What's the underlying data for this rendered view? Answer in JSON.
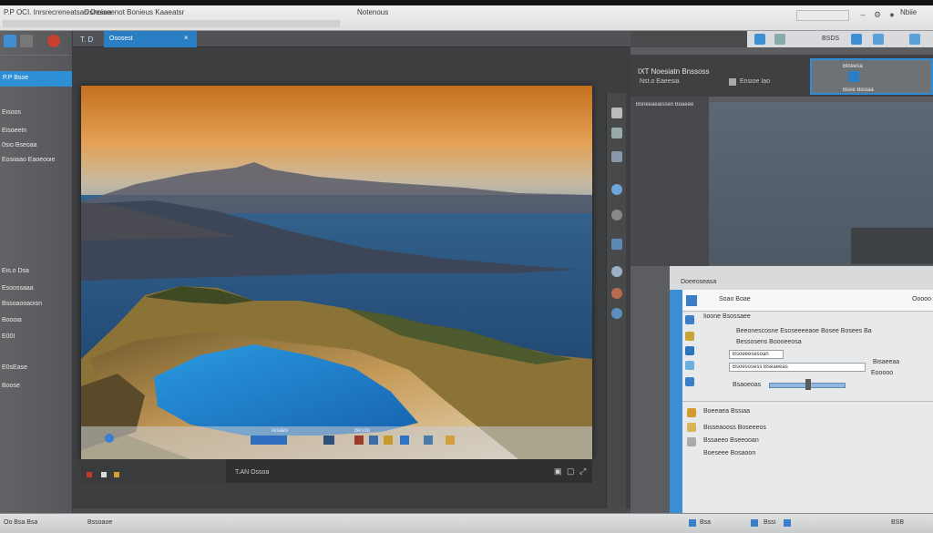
{
  "titlebar": {
    "left_text": "P.P OCI. Inrsrecreneatsan Oesea",
    "mid_text": "Osnoiseenot Bonieus Kaaeatsr",
    "center_text": "Notenous",
    "right_text": "Nbiie"
  },
  "doc_tabs": {
    "label1": "T. D",
    "label2": "Ososest"
  },
  "sidebar": {
    "active_item": "P.P   Bsoe",
    "items": [
      "Eisoos",
      "Eisoeetn",
      "0sio Bseoaa",
      "Eosiiaao Eaoeooie",
      "Eis.o Dsa",
      "Esoossaaa",
      "Bssoaooaoisn",
      "Boooia",
      "E00I",
      "E0sEase",
      "Boose"
    ]
  },
  "rightpanel": {
    "top_label": "BSDS",
    "header_title": "IXT Noesiatn Bnssoss",
    "header_sub1": "Nst.o Eaeesia",
    "header_sub2": "Ensioe Iao",
    "thumb_label1": "Bloeesa",
    "thumb_label2": "Bsoe Bisoaa",
    "mid_label": "Bsneeaeaissen Boaeee",
    "lower_title": "Doeeoseasa",
    "inner_label": "Soao Boae",
    "inner_right": "Ooooo",
    "rows": [
      "Iioone Bsossaee",
      "Beeonescosne Esoseeeeaoe Bosee Bosees Ba",
      "Bessosens Boooeeosa",
      "Bsoeeesesoan",
      "Bsoesosess Bseaeeas",
      "Bsaoeoas",
      "Boeeaea Bssiaa",
      "Bisseaooss Boseeeos",
      "Bssaeeo Bseeooan",
      "Boeseee Bosaoon"
    ],
    "right_col": [
      "Bisaeeaa",
      "Eooooo"
    ]
  },
  "canvas": {
    "taskbar_label1": "Tesaes",
    "taskbar_label2": "Besoo",
    "status_label": "T.AN  Ossoa"
  },
  "bottombar": {
    "left": "Oo Bsa  Bsa",
    "mid": "Bssoaoe",
    "right1": "Bsa",
    "right2": "Bssi",
    "right3": "BSB"
  },
  "colors": {
    "accent": "#2d8fd6",
    "workspace": "#3d3e40",
    "panel": "#5b5d60"
  }
}
